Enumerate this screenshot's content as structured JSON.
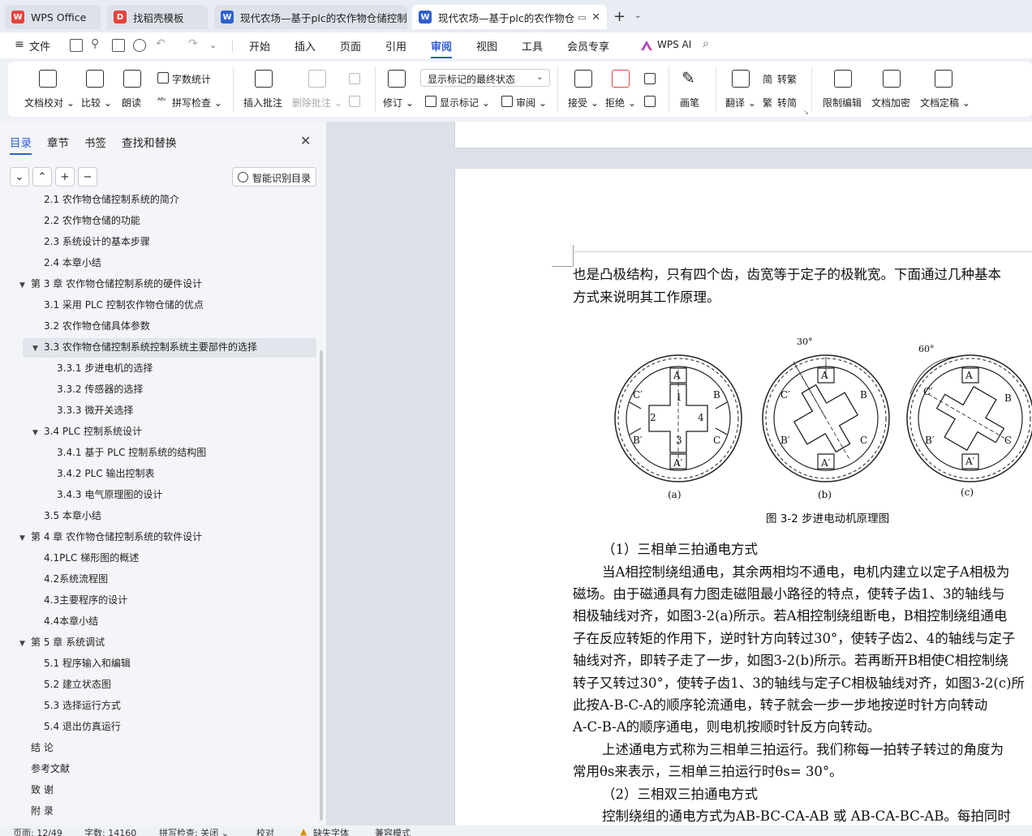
{
  "tabs": [
    {
      "label": "WPS Office",
      "logo_color": "#e8433e"
    },
    {
      "label": "找稻壳模板",
      "logo_color": "#e8433e"
    },
    {
      "label": "现代农场—基于plc的农作物仓储控制",
      "logo_color": "#2f5fd0"
    },
    {
      "label": "现代农场—基于plc的农作物仓",
      "logo_color": "#2f5fd0"
    }
  ],
  "menu": {
    "file": "文件",
    "items": [
      "开始",
      "插入",
      "页面",
      "引用",
      "审阅",
      "视图",
      "工具",
      "会员专享"
    ],
    "active": "审阅",
    "ai": "WPS AI"
  },
  "ribbon": {
    "doc_check": "文档校对",
    "compare": "比较",
    "read_aloud": "朗读",
    "word_count": "字数统计",
    "spell_check": "拼写检查",
    "insert_comment": "插入批注",
    "delete_comment": "删除批注",
    "revise": "修订",
    "markup_mode": "显示标记的最终状态",
    "show_markup": "显示标记",
    "review": "审阅",
    "accept": "接受",
    "reject": "拒绝",
    "pen": "画笔",
    "translate": "翻译",
    "to_traditional": "转繁",
    "to_simplified": "转简",
    "restrict_edit": "限制编辑",
    "encrypt": "文档加密",
    "finalize": "文档定稿"
  },
  "left_panel": {
    "tabs": [
      "目录",
      "章节",
      "书签",
      "查找和替换"
    ],
    "smart_toc": "智能识别目录",
    "toc": [
      {
        "label": "2.1 农作物仓储控制系统的简介",
        "level": 2
      },
      {
        "label": "2.2 农作物仓储的功能",
        "level": 2
      },
      {
        "label": "2.3 系统设计的基本步骤",
        "level": 2
      },
      {
        "label": "2.4 本章小结",
        "level": 2
      },
      {
        "label": "第 3 章 农作物仓储控制系统的硬件设计",
        "level": 1,
        "expanded": true
      },
      {
        "label": "3.1 采用 PLC 控制农作物仓储的优点",
        "level": 2
      },
      {
        "label": "3.2 农作物仓储具体参数",
        "level": 2
      },
      {
        "label": "3.3 农作物仓储控制系统控制系统主要部件的选择",
        "level": 2,
        "expanded": true,
        "selected": true
      },
      {
        "label": "3.3.1 步进电机的选择",
        "level": 3
      },
      {
        "label": "3.3.2 传感器的选择",
        "level": 3
      },
      {
        "label": "3.3.3 微开关选择",
        "level": 3
      },
      {
        "label": "3.4 PLC 控制系统设计",
        "level": 2,
        "expanded": true
      },
      {
        "label": "3.4.1 基于 PLC 控制系统的结构图",
        "level": 3
      },
      {
        "label": "3.4.2 PLC 输出控制表",
        "level": 3
      },
      {
        "label": "3.4.3 电气原理图的设计",
        "level": 3
      },
      {
        "label": "3.5 本章小结",
        "level": 2
      },
      {
        "label": "第 4 章 农作物仓储控制系统的软件设计",
        "level": 1,
        "expanded": true
      },
      {
        "label": "4.1PLC 梯形图的概述",
        "level": 2
      },
      {
        "label": "4.2系统流程图",
        "level": 2
      },
      {
        "label": "4.3主要程序的设计",
        "level": 2
      },
      {
        "label": "4.4本章小结",
        "level": 2
      },
      {
        "label": "第 5 章 系统调试",
        "level": 1,
        "expanded": true
      },
      {
        "label": "5.1 程序输入和编辑",
        "level": 2
      },
      {
        "label": "5.2 建立状态图",
        "level": 2
      },
      {
        "label": "5.3 选择运行方式",
        "level": 2
      },
      {
        "label": "5.4 退出仿真运行",
        "level": 2
      },
      {
        "label": "结 论",
        "level": 1
      },
      {
        "label": "参考文献",
        "level": 1
      },
      {
        "label": "致 谢",
        "level": 1
      },
      {
        "label": "附 录",
        "level": 1
      }
    ]
  },
  "document": {
    "lines": [
      "也是凸极结构，只有四个齿，齿宽等于定子的极靴宽。下面通过几种基本",
      "方式来说明其工作原理。"
    ],
    "figure": {
      "caption": "图 3-2  步进电动机原理图",
      "sub_labels": [
        "(a)",
        "(b)",
        "(c)"
      ],
      "angles": [
        "30°",
        "60°"
      ]
    },
    "section1": "（1）三相单三拍通电方式",
    "para1": [
      "当A相控制绕组通电，其余两相均不通电，电机内建立以定子A相极为",
      "磁场。由于磁通具有力图走磁阻最小路径的特点，使转子齿1、3的轴线与",
      "相极轴线对齐，如图3-2(a)所示。若A相控制绕组断电，B相控制绕组通电",
      "子在反应转矩的作用下，逆时针方向转过30°，使转子齿2、4的轴线与定子",
      "轴线对齐，即转子走了一步，如图3-2(b)所示。若再断开B相使C相控制绕",
      "转子又转过30°，使转子齿1、3的轴线与定子C相极轴线对齐，如图3-2(c)所",
      "此按A-B-C-A的顺序轮流通电，转子就会一步一步地按逆时针方向转动",
      "A-C-B-A的顺序通电，则电机按顺时针反方向转动。"
    ],
    "para2": [
      "上述通电方式称为三相单三拍运行。我们称每一拍转子转过的角度为",
      "常用θs来表示，三相单三拍运行时θs= 30°。"
    ],
    "section2": "（2）三相双三拍通电方式",
    "para3": "控制绕组的通电方式为AB-BC-CA-AB 或 AB-CA-BC-AB。每拍同时"
  },
  "status": {
    "page": "页面: 12/49",
    "words": "字数: 14160",
    "spell": "拼写检查: 关闭",
    "proof": "校对",
    "missing_font": "缺失字体",
    "compat": "兼容模式"
  }
}
